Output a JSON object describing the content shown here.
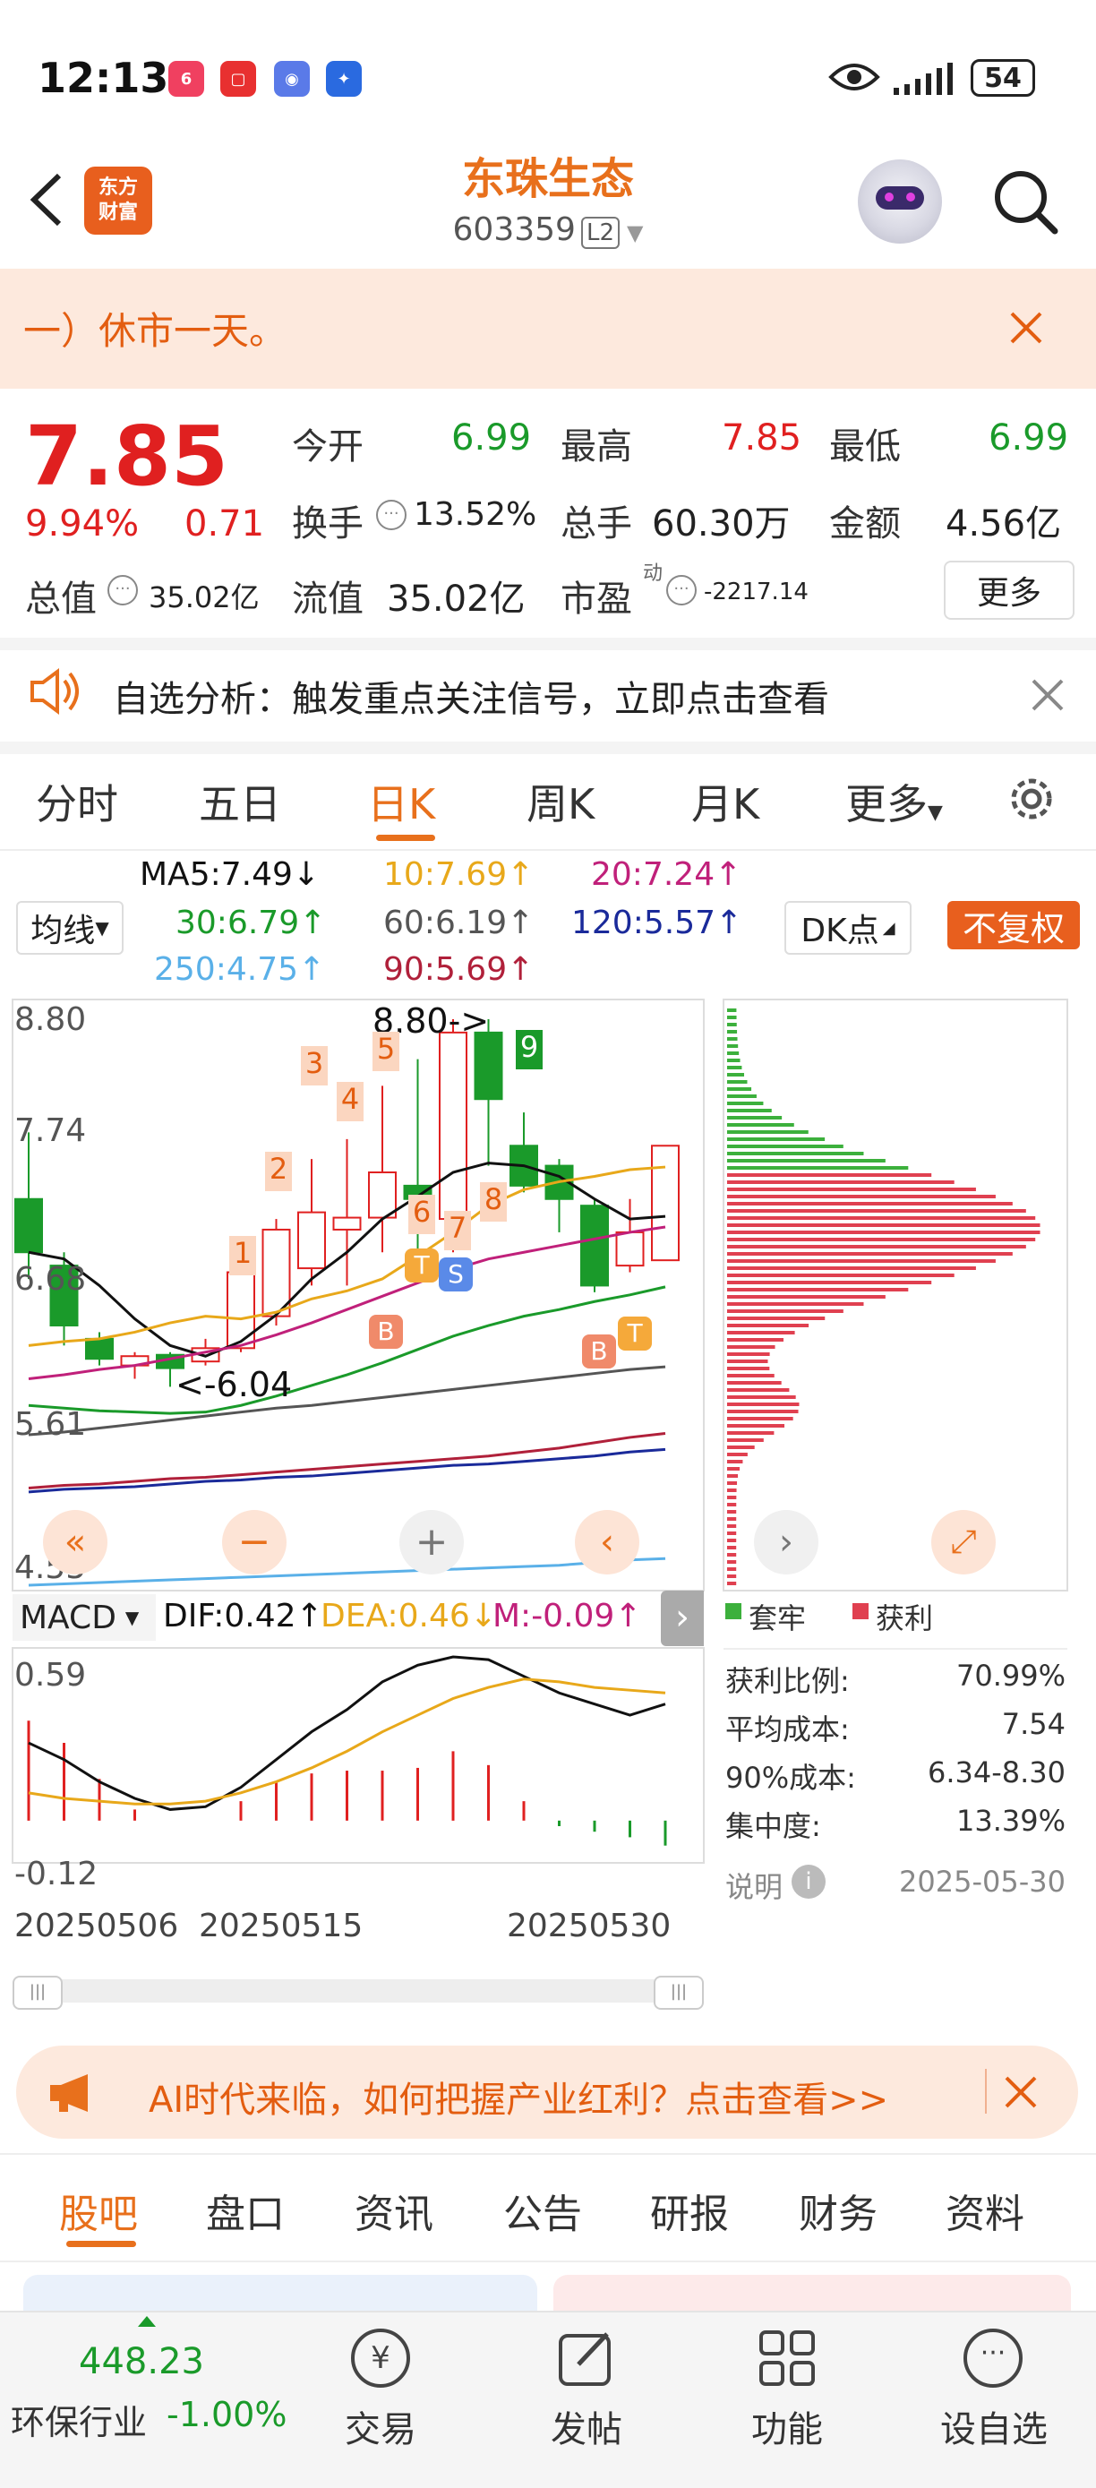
{
  "status_bar": {
    "time": "12:13",
    "battery": "54",
    "app_icons": [
      "618-app-icon",
      "huawei-store-icon",
      "browser-icon",
      "lightbulb-icon"
    ]
  },
  "header": {
    "stock_name": "东珠生态",
    "stock_code": "603359",
    "level": "L2",
    "logo_line1": "东方",
    "logo_line2": "财富"
  },
  "notice": {
    "text": "一）休市一天。"
  },
  "quote": {
    "price": "7.85",
    "change_pct": "9.94%",
    "change": "0.71",
    "open_label": "今开",
    "open": "6.99",
    "high_label": "最高",
    "high": "7.85",
    "low_label": "最低",
    "low": "6.99",
    "turnover_label": "换手",
    "turnover": "13.52%",
    "volume_label": "总手",
    "volume": "60.30万",
    "amount_label": "金额",
    "amount": "4.56亿",
    "mcap_label": "总值",
    "mcap": "35.02亿",
    "float_label": "流值",
    "float": "35.02亿",
    "pe_label": "市盈",
    "pe_sup": "动",
    "pe": "-2217.14",
    "more": "更多"
  },
  "alert": {
    "text": "自选分析：触发重点关注信号，立即点击查看"
  },
  "kline_tabs": [
    "分时",
    "五日",
    "日K",
    "周K",
    "月K",
    "更多"
  ],
  "kline_active": "日K",
  "ma_legend": {
    "ma5": "MA5:7.49↓",
    "ma10": "10:7.69↑",
    "ma20": "20:7.24↑",
    "ma30": "30:6.79↑",
    "ma60": "60:6.19↑",
    "ma120": "120:5.57↑",
    "ma250": "250:4.75↑",
    "ma90": "90:5.69↑",
    "selector": "均线",
    "dk": "DK点",
    "adjust": "不复权"
  },
  "colors": {
    "up": "#e02020",
    "down": "#1a9a2a",
    "accent": "#e8701c",
    "ma5": "#111111",
    "ma10": "#e8a81a",
    "ma20": "#c0207a",
    "ma30": "#1a9a2a",
    "ma60": "#555555",
    "ma120": "#1a2a9a",
    "ma250": "#5ab0e8",
    "ma90": "#b0203a"
  },
  "chart_data": {
    "type": "candlestick",
    "y_ticks": [
      "8.80",
      "7.74",
      "6.68",
      "5.61",
      "4.55"
    ],
    "ylim": [
      4.55,
      8.8
    ],
    "annotations": {
      "high_marker": "8.80->",
      "low_marker": "<-6.04"
    },
    "signal_numbers": [
      "1",
      "2",
      "3",
      "4",
      "5",
      "6",
      "7",
      "8",
      "9"
    ],
    "signal_letters": [
      "B",
      "T",
      "S",
      "B",
      "T"
    ],
    "candles": [
      {
        "o": 7.45,
        "c": 7.05,
        "h": 7.95,
        "l": 6.85
      },
      {
        "o": 6.95,
        "c": 6.5,
        "h": 7.05,
        "l": 6.35
      },
      {
        "o": 6.4,
        "c": 6.25,
        "h": 6.45,
        "l": 6.2
      },
      {
        "o": 6.2,
        "c": 6.27,
        "h": 6.3,
        "l": 6.1
      },
      {
        "o": 6.28,
        "c": 6.18,
        "h": 6.3,
        "l": 6.04
      },
      {
        "o": 6.23,
        "c": 6.33,
        "h": 6.4,
        "l": 6.2
      },
      {
        "o": 6.33,
        "c": 6.9,
        "h": 6.95,
        "l": 6.3
      },
      {
        "o": 6.57,
        "c": 7.22,
        "h": 7.3,
        "l": 6.5
      },
      {
        "o": 6.93,
        "c": 7.35,
        "h": 7.75,
        "l": 6.8
      },
      {
        "o": 7.22,
        "c": 7.31,
        "h": 7.9,
        "l": 6.8
      },
      {
        "o": 7.31,
        "c": 7.65,
        "h": 8.3,
        "l": 7.05
      },
      {
        "o": 7.55,
        "c": 7.45,
        "h": 8.5,
        "l": 7.0
      },
      {
        "o": 7.3,
        "c": 8.7,
        "h": 8.8,
        "l": 7.05
      },
      {
        "o": 8.7,
        "c": 8.2,
        "h": 8.8,
        "l": 7.7
      },
      {
        "o": 7.85,
        "c": 7.55,
        "h": 8.1,
        "l": 7.5
      },
      {
        "o": 7.7,
        "c": 7.45,
        "h": 7.75,
        "l": 7.2
      },
      {
        "o": 7.4,
        "c": 6.8,
        "h": 7.45,
        "l": 6.75
      },
      {
        "o": 6.95,
        "c": 7.2,
        "h": 7.45,
        "l": 6.9
      },
      {
        "o": 6.99,
        "c": 7.85,
        "h": 7.85,
        "l": 6.99
      }
    ],
    "ma_lines": {
      "ma5": [
        7.05,
        7.0,
        6.8,
        6.55,
        6.35,
        6.27,
        6.38,
        6.58,
        6.85,
        7.05,
        7.3,
        7.47,
        7.65,
        7.72,
        7.7,
        7.62,
        7.45,
        7.3,
        7.32
      ],
      "ma10": [
        6.35,
        6.38,
        6.4,
        6.45,
        6.52,
        6.57,
        6.55,
        6.6,
        6.7,
        6.76,
        6.85,
        7.02,
        7.2,
        7.4,
        7.52,
        7.58,
        7.62,
        7.67,
        7.69
      ],
      "ma20": [
        6.1,
        6.13,
        6.17,
        6.2,
        6.25,
        6.3,
        6.35,
        6.43,
        6.52,
        6.62,
        6.72,
        6.82,
        6.92,
        7.0,
        7.05,
        7.1,
        7.15,
        7.2,
        7.24
      ],
      "ma30": [
        5.9,
        5.88,
        5.86,
        5.85,
        5.84,
        5.85,
        5.9,
        5.97,
        6.05,
        6.13,
        6.22,
        6.32,
        6.42,
        6.5,
        6.57,
        6.62,
        6.68,
        6.73,
        6.79
      ],
      "ma60": [
        5.68,
        5.7,
        5.73,
        5.76,
        5.79,
        5.82,
        5.85,
        5.88,
        5.9,
        5.93,
        5.96,
        5.99,
        6.02,
        6.05,
        6.08,
        6.11,
        6.14,
        6.17,
        6.19
      ],
      "ma90": [
        5.28,
        5.3,
        5.31,
        5.33,
        5.35,
        5.36,
        5.38,
        5.4,
        5.42,
        5.44,
        5.46,
        5.48,
        5.5,
        5.52,
        5.55,
        5.58,
        5.62,
        5.66,
        5.69
      ],
      "ma120": [
        5.25,
        5.27,
        5.28,
        5.29,
        5.31,
        5.33,
        5.34,
        5.36,
        5.37,
        5.39,
        5.41,
        5.43,
        5.45,
        5.46,
        5.48,
        5.5,
        5.52,
        5.55,
        5.57
      ],
      "ma250": [
        4.55,
        4.56,
        4.57,
        4.58,
        4.59,
        4.6,
        4.61,
        4.62,
        4.63,
        4.64,
        4.65,
        4.66,
        4.67,
        4.68,
        4.69,
        4.7,
        4.72,
        4.74,
        4.75
      ]
    },
    "macd": {
      "label": "MACD",
      "dif": "DIF:0.42↑",
      "dea": "DEA:0.46↓",
      "m": "M:-0.09↑",
      "y_ticks": [
        "0.59",
        "-0.12"
      ],
      "ylim": [
        -0.12,
        0.59
      ],
      "dif_line": [
        0.28,
        0.22,
        0.14,
        0.08,
        0.04,
        0.05,
        0.12,
        0.22,
        0.32,
        0.4,
        0.5,
        0.56,
        0.59,
        0.58,
        0.52,
        0.46,
        0.42,
        0.38,
        0.42
      ],
      "dea_line": [
        0.1,
        0.08,
        0.07,
        0.06,
        0.06,
        0.07,
        0.1,
        0.14,
        0.19,
        0.25,
        0.32,
        0.38,
        0.44,
        0.48,
        0.51,
        0.5,
        0.48,
        0.47,
        0.46
      ],
      "bars": [
        0.36,
        0.28,
        0.15,
        0.04,
        0.0,
        0.0,
        0.07,
        0.14,
        0.17,
        0.18,
        0.18,
        0.19,
        0.25,
        0.2,
        0.07,
        -0.02,
        -0.04,
        -0.06,
        -0.09
      ]
    },
    "dates": [
      "20250506",
      "20250515",
      "20250530"
    ],
    "chip_legend": [
      "套牢",
      "获利"
    ],
    "chip_stats": [
      {
        "label": "获利比例:",
        "value": "70.99%"
      },
      {
        "label": "平均成本:",
        "value": "7.54"
      },
      {
        "label": "90%成本:",
        "value": "6.34-8.30"
      },
      {
        "label": "集中度:",
        "value": "13.39%"
      }
    ],
    "chip_note": "说明",
    "chip_date": "2025-05-30"
  },
  "banner": {
    "text": "AI时代来临，如何把握产业红利？点击查看>>"
  },
  "bottom_tabs": [
    "股吧",
    "盘口",
    "资讯",
    "公告",
    "研报",
    "财务",
    "资料"
  ],
  "bottom_active": "股吧",
  "nav": {
    "index_value": "448.23",
    "index_name": "环保行业",
    "index_change": "-1.00%",
    "items": [
      "交易",
      "发帖",
      "功能",
      "设自选"
    ]
  }
}
